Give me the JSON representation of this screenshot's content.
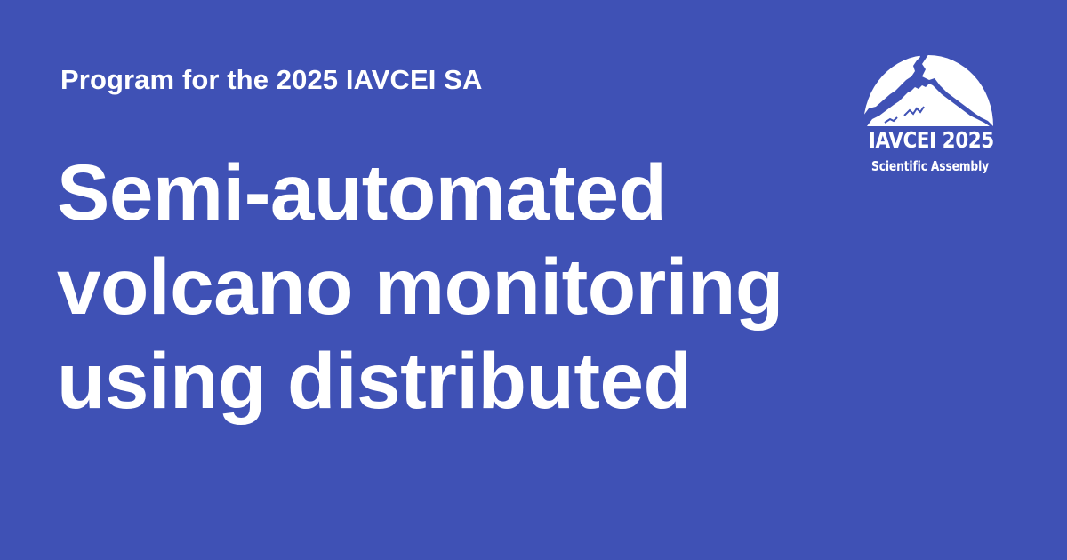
{
  "header": {
    "kicker": "Program for the 2025 IAVCEI SA"
  },
  "title": {
    "lines": [
      "Semi-automated",
      "volcano monitoring",
      "using distributed"
    ]
  },
  "logo": {
    "icon": "volcano-mountain-icon",
    "year_text": "IAVCEI 2025",
    "subtitle": "Scientific Assembly"
  },
  "colors": {
    "background": "#3f51b5",
    "text": "#ffffff"
  }
}
